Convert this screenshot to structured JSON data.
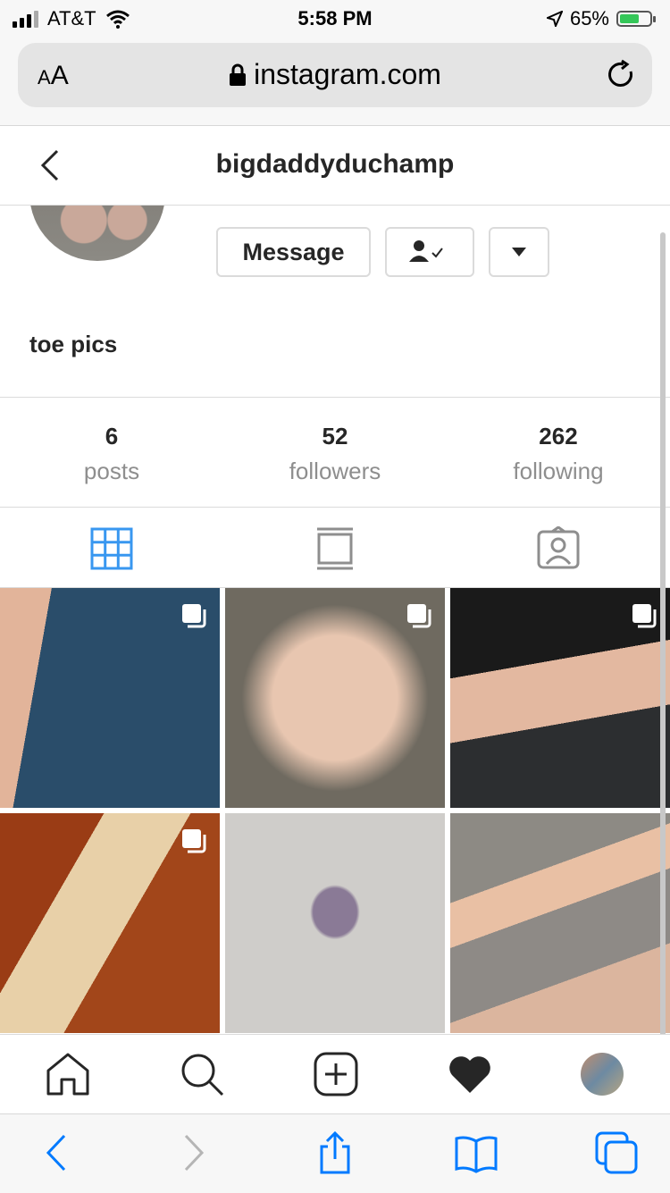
{
  "status_bar": {
    "carrier": "AT&T",
    "time": "5:58 PM",
    "battery": "65%",
    "battery_level": 0.65
  },
  "safari": {
    "text_size_label_small": "A",
    "text_size_label_large": "A",
    "url": "instagram.com"
  },
  "header": {
    "username": "bigdaddyduchamp"
  },
  "profile": {
    "bio": "toe pics",
    "message_label": "Message",
    "stats": [
      {
        "value": "6",
        "label": "posts"
      },
      {
        "value": "52",
        "label": "followers"
      },
      {
        "value": "262",
        "label": "following"
      }
    ]
  },
  "tabs": [
    {
      "icon": "grid-icon",
      "active": true
    },
    {
      "icon": "feed-icon",
      "active": false
    },
    {
      "icon": "tagged-icon",
      "active": false
    }
  ],
  "posts": [
    {
      "multi": true
    },
    {
      "multi": true
    },
    {
      "multi": true
    },
    {
      "multi": true
    },
    {
      "multi": false
    },
    {
      "multi": false
    }
  ],
  "colors": {
    "accent": "#3897f0",
    "border": "#dbdbdb",
    "muted": "#8e8e8e",
    "ios_blue": "#007aff"
  }
}
